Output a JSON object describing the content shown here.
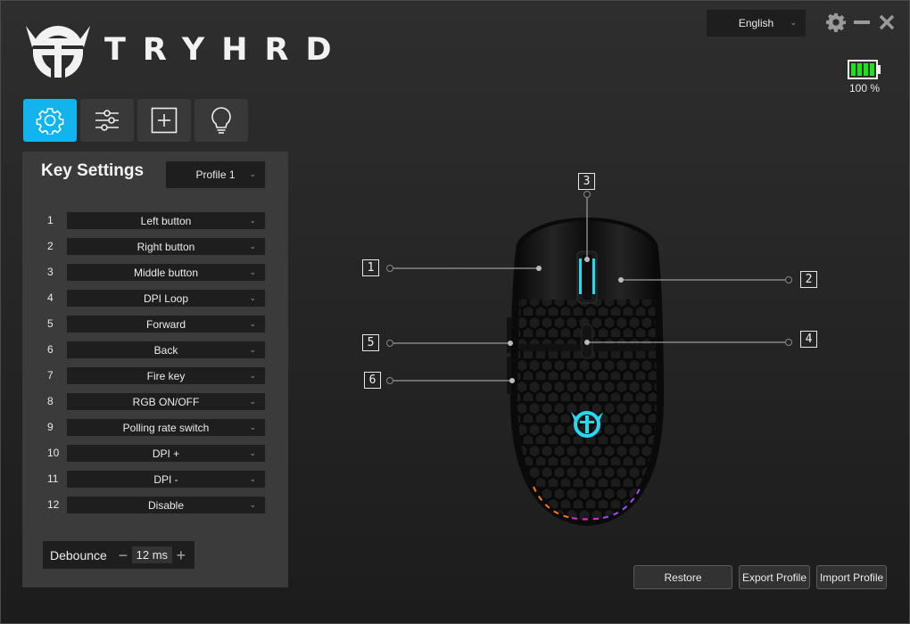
{
  "app": {
    "brand": "TRYHRD"
  },
  "header": {
    "language": {
      "selected": "English"
    },
    "battery": {
      "percent_label": "100 %",
      "level": 1.0,
      "color": "#19e619"
    }
  },
  "tabs": [
    {
      "name": "key-settings",
      "icon": "gear-icon",
      "active": true
    },
    {
      "name": "performance",
      "icon": "sliders-icon",
      "active": false
    },
    {
      "name": "macro",
      "icon": "add-box-icon",
      "active": false
    },
    {
      "name": "lighting",
      "icon": "lightbulb-icon",
      "active": false
    }
  ],
  "key_settings": {
    "title": "Key Settings",
    "profile": {
      "selected": "Profile 1"
    },
    "keys": [
      {
        "num": "1",
        "value": "Left button"
      },
      {
        "num": "2",
        "value": "Right button"
      },
      {
        "num": "3",
        "value": "Middle button"
      },
      {
        "num": "4",
        "value": "DPI Loop"
      },
      {
        "num": "5",
        "value": "Forward"
      },
      {
        "num": "6",
        "value": "Back"
      },
      {
        "num": "7",
        "value": "Fire key"
      },
      {
        "num": "8",
        "value": "RGB ON/OFF"
      },
      {
        "num": "9",
        "value": "Polling rate switch"
      },
      {
        "num": "10",
        "value": "DPI +"
      },
      {
        "num": "11",
        "value": "DPI -"
      },
      {
        "num": "12",
        "value": "Disable"
      }
    ],
    "debounce": {
      "label": "Debounce",
      "value": "12 ms",
      "minus": "−",
      "plus": "+"
    }
  },
  "mouse_callouts": [
    "1",
    "2",
    "3",
    "4",
    "5",
    "6"
  ],
  "footer": {
    "restore": "Restore",
    "export": "Export Profile",
    "import": "Import Profile"
  },
  "colors": {
    "accent": "#12b4ee",
    "mouse_led": "#27d9ee"
  }
}
